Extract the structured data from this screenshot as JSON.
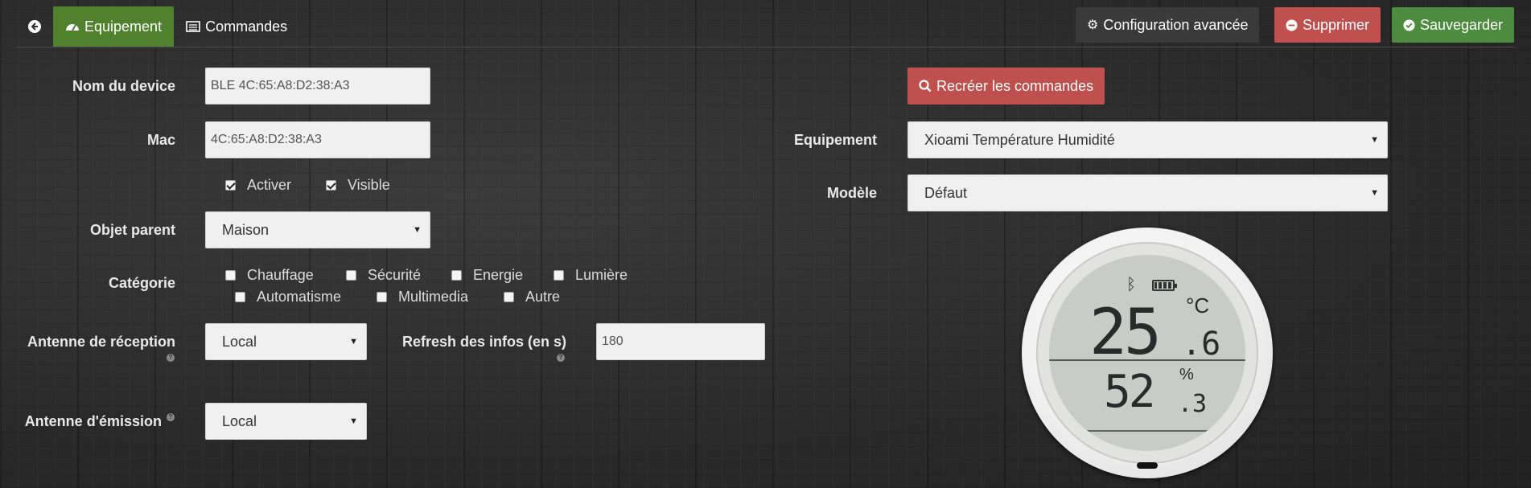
{
  "tabs": {
    "equipement_label": "Equipement",
    "commandes_label": "Commandes"
  },
  "toolbar": {
    "config_label": "Configuration avancée",
    "delete_label": "Supprimer",
    "save_label": "Sauvegarder"
  },
  "form": {
    "device_name": {
      "label": "Nom du device",
      "value": "BLE  4C:65:A8:D2:38:A3"
    },
    "mac": {
      "label": "Mac",
      "value": "4C:65:A8:D2:38:A3"
    },
    "activer": {
      "label": "Activer",
      "checked": true
    },
    "visible": {
      "label": "Visible",
      "checked": true
    },
    "parent": {
      "label": "Objet parent",
      "value": "Maison"
    },
    "category": {
      "label": "Catégorie",
      "options": [
        "Chauffage",
        "Sécurité",
        "Energie",
        "Lumière",
        "Automatisme",
        "Multimedia",
        "Autre"
      ]
    },
    "rx_antenna": {
      "label": "Antenne de réception",
      "value": "Local"
    },
    "refresh": {
      "label": "Refresh des infos (en s)",
      "value": "180"
    },
    "tx_antenna": {
      "label": "Antenne d'émission",
      "value": "Local"
    },
    "recreate_label": "Recréer les commandes",
    "equipement": {
      "label": "Equipement",
      "value": "Xioami Température Humidité"
    },
    "model": {
      "label": "Modèle",
      "value": "Défaut"
    }
  },
  "device_display": {
    "temperature_int": "25",
    "temperature_dec": ".6",
    "temperature_unit": "°C",
    "humidity_int": "52",
    "humidity_dec": ".3",
    "humidity_unit": "%"
  },
  "colors": {
    "green": "#50822e",
    "red": "#c0504d",
    "dark_button": "#3a3a3a"
  }
}
